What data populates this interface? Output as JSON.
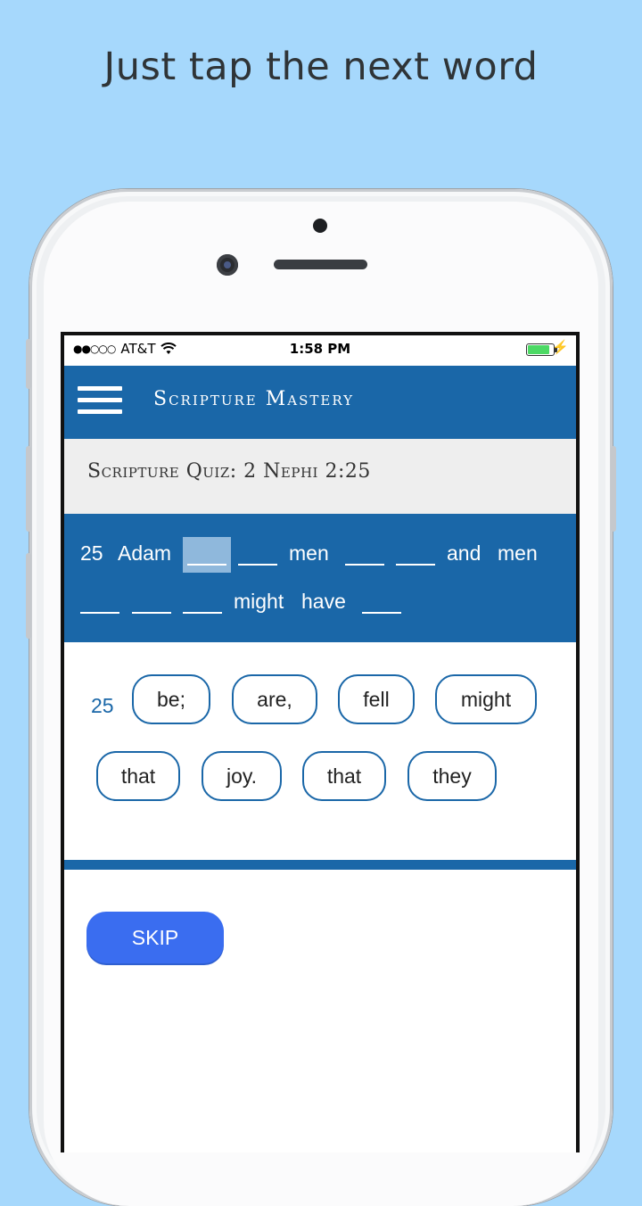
{
  "headline": "Just tap the next word",
  "status_bar": {
    "carrier": "AT&T",
    "time": "1:58 PM"
  },
  "app_bar": {
    "title": "Scripture Mastery"
  },
  "quiz": {
    "title": "Scripture Quiz: 2 Nephi 2:25"
  },
  "verse": {
    "number": "25",
    "words": [
      "Adam",
      "men",
      "and",
      "men",
      "might",
      "have"
    ],
    "blank": "___"
  },
  "options": {
    "verse_number": "25",
    "words": [
      "be;",
      "are,",
      "fell",
      "might",
      "that",
      "joy.",
      "that",
      "they"
    ]
  },
  "skip_label": "SKIP",
  "colors": {
    "background": "#a6d8fc",
    "primary": "#1a67a8",
    "skip_button": "#3a6df0",
    "active_blank": "#8fb8dc"
  }
}
